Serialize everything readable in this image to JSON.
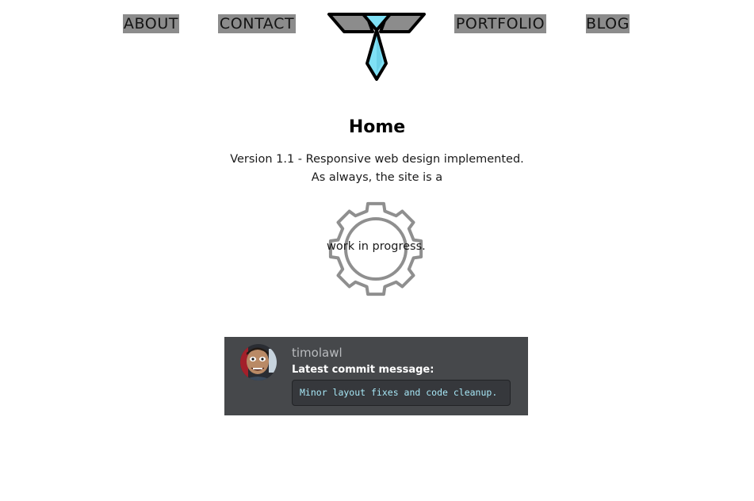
{
  "nav": {
    "about": "ABOUT",
    "contact": "CONTACT",
    "portfolio": "PORTFOLIO",
    "blog": "BLOG",
    "logo_icon": "tie-logo-icon"
  },
  "main": {
    "title": "Home",
    "intro_line_1": "Version 1.1 - Responsive web design implemented.",
    "intro_line_2": "As always, the site is a",
    "gear_icon": "gear-icon",
    "gear_text": "work in progress."
  },
  "commit": {
    "username": "timolawl",
    "heading": "Latest commit message:",
    "message": "Minor layout fixes and code cleanup.",
    "avatar_icon": "avatar-icon"
  },
  "colors": {
    "nav_background": "#8c8c8c",
    "tie_blue": "#7fe0f5",
    "card_background": "#46484b",
    "commit_text": "#a6e6f5",
    "gear_stroke": "#8f8f8f"
  }
}
